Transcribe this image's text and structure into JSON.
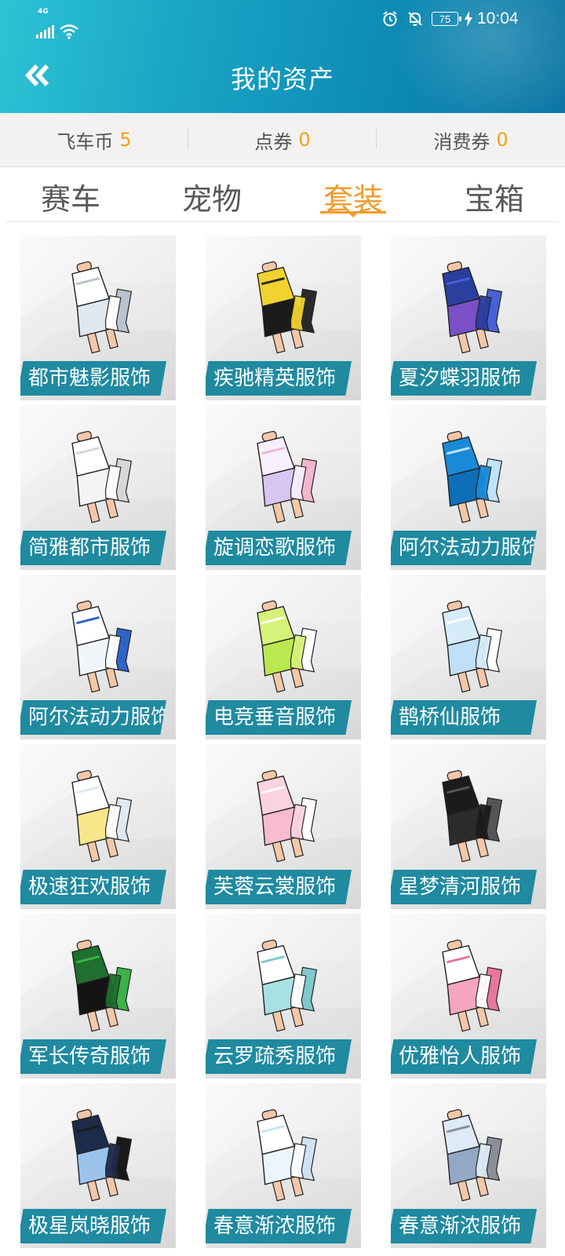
{
  "status_bar": {
    "network": "4G",
    "battery": "75",
    "time": "10:04",
    "icons": [
      "signal-icon",
      "wifi-icon",
      "alarm-icon",
      "mute-icon",
      "battery-icon",
      "charging-icon"
    ]
  },
  "nav": {
    "title": "我的资产",
    "back_icon": "double-chevron-left-icon"
  },
  "currency": [
    {
      "label": "飞车币",
      "value": "5"
    },
    {
      "label": "点券",
      "value": "0"
    },
    {
      "label": "消费券",
      "value": "0"
    }
  ],
  "tabs": [
    {
      "label": "赛车",
      "active": false
    },
    {
      "label": "宠物",
      "active": false
    },
    {
      "label": "套装",
      "active": true
    },
    {
      "label": "宝箱",
      "active": false
    }
  ],
  "colors": {
    "accent": "#f29a2b",
    "header": "#1aa7c6",
    "label_bg": "#1f8aa0"
  },
  "items": [
    {
      "name": "都市魅影服饰",
      "top": "#ffffff",
      "bottom": "#dfe7ef",
      "skin": "#f3c7a8",
      "accent": "#b8c4cf"
    },
    {
      "name": "疾驰精英服饰",
      "top": "#f2d230",
      "bottom": "#1b1b1b",
      "skin": "#f3c7a8",
      "accent": "#2a2a2a"
    },
    {
      "name": "夏汐蝶羽服饰",
      "top": "#2a3f9e",
      "bottom": "#7a4fc7",
      "skin": "#f3c7a8",
      "accent": "#4860d8"
    },
    {
      "name": "简雅都市服饰",
      "top": "#ffffff",
      "bottom": "#f4f4f4",
      "skin": "#f3c7a8",
      "accent": "#d7d7d7"
    },
    {
      "name": "旋调恋歌服饰",
      "top": "#f6f0ff",
      "bottom": "#d7c6f1",
      "skin": "#f3c7a8",
      "accent": "#f2b6cf"
    },
    {
      "name": "阿尔法动力服饰",
      "top": "#1a8ad8",
      "bottom": "#0d6fb8",
      "skin": "#f3c7a8",
      "accent": "#bfe3fb"
    },
    {
      "name": "阿尔法动力服饰",
      "top": "#ffffff",
      "bottom": "#f2f6fb",
      "skin": "#f3c7a8",
      "accent": "#2d64c7"
    },
    {
      "name": "电竞垂音服饰",
      "top": "#d7f27a",
      "bottom": "#b9e84f",
      "skin": "#f3c7a8",
      "accent": "#ffffff"
    },
    {
      "name": "鹊桥仙服饰",
      "top": "#d6ecfb",
      "bottom": "#bfe0f7",
      "skin": "#f3c7a8",
      "accent": "#ffffff"
    },
    {
      "name": "极速狂欢服饰",
      "top": "#ffffff",
      "bottom": "#f6e88a",
      "skin": "#f3c7a8",
      "accent": "#dfe9f2"
    },
    {
      "name": "芙蓉云裳服饰",
      "top": "#fbd3df",
      "bottom": "#f7bccd",
      "skin": "#f3c7a8",
      "accent": "#ffffff"
    },
    {
      "name": "星梦清河服饰",
      "top": "#1b1b1b",
      "bottom": "#2b2b2b",
      "skin": "#f3c7a8",
      "accent": "#555555"
    },
    {
      "name": "军长传奇服饰",
      "top": "#1f6f2e",
      "bottom": "#141414",
      "skin": "#f3c7a8",
      "accent": "#3bb34a"
    },
    {
      "name": "云罗疏秀服饰",
      "top": "#ffffff",
      "bottom": "#a9e0e3",
      "skin": "#f3c7a8",
      "accent": "#7fc8cc"
    },
    {
      "name": "优雅怡人服饰",
      "top": "#ffffff",
      "bottom": "#f6a6be",
      "skin": "#f3c7a8",
      "accent": "#e8769a"
    },
    {
      "name": "极星岚晓服饰",
      "top": "#1d2b4a",
      "bottom": "#9cc3ec",
      "skin": "#f3c7a8",
      "accent": "#1a1a1a"
    },
    {
      "name": "春意渐浓服饰",
      "top": "#ffffff",
      "bottom": "#eef4fb",
      "skin": "#f3c7a8",
      "accent": "#cfe2f5"
    },
    {
      "name": "春意渐浓服饰",
      "top": "#dfeaf7",
      "bottom": "#93a8c4",
      "skin": "#f3c7a8",
      "accent": "#8a8f97"
    }
  ]
}
